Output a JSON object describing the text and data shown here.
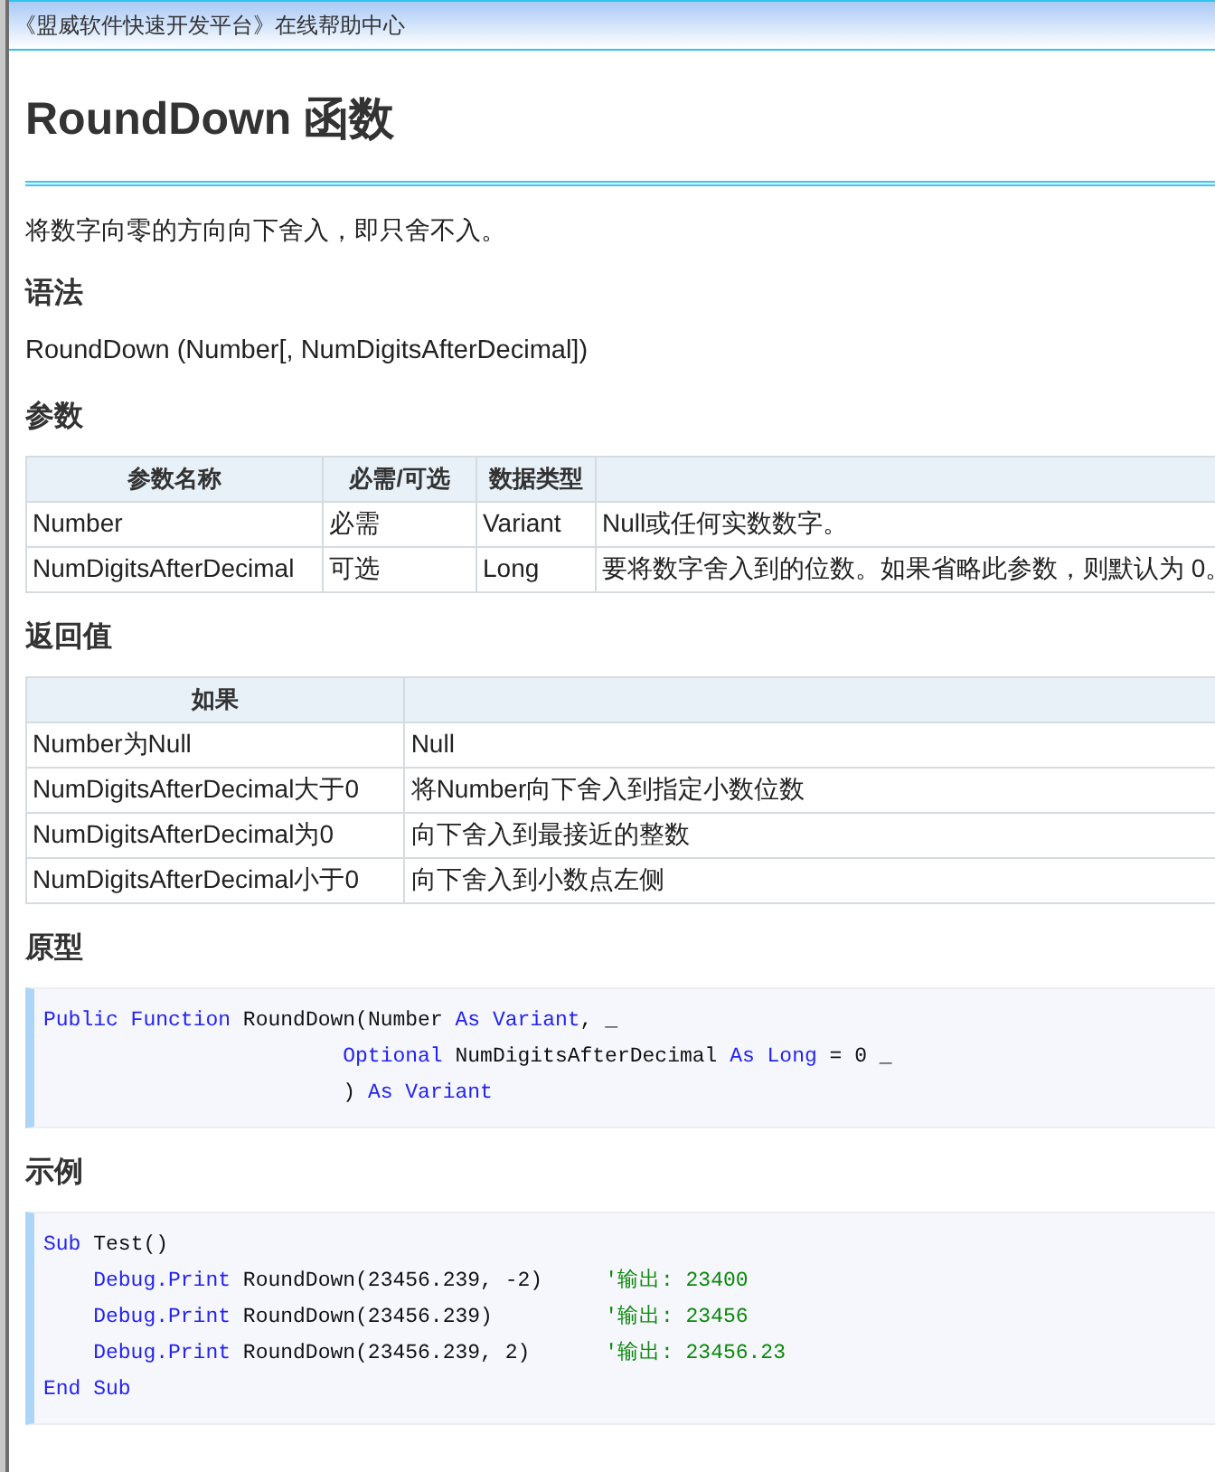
{
  "header": {
    "title": "《盟威软件快速开发平台》在线帮助中心"
  },
  "page_title": "RoundDown 函数",
  "description": "将数字向零的方向向下舍入，即只舍不入。",
  "sections": [
    {
      "kind": "text",
      "heading": "语法",
      "text": "RoundDown (Number[, NumDigitsAfterDecimal])"
    },
    {
      "kind": "table",
      "heading": "参数",
      "columns": [
        "参数名称",
        "必需/可选",
        "数据类型"
      ],
      "rows": [
        [
          "Number",
          "必需",
          "Variant",
          "Null或任何实数数字。"
        ],
        [
          "NumDigitsAfterDecimal",
          "可选",
          "Long",
          "要将数字舍入到的位数。如果省略此参数，则默认为 0。"
        ]
      ]
    },
    {
      "kind": "table",
      "heading": "返回值",
      "columns": [
        "如果"
      ],
      "rows": [
        [
          "Number为Null",
          "Null"
        ],
        [
          "NumDigitsAfterDecimal大于0",
          "将Number向下舍入到指定小数位数"
        ],
        [
          "NumDigitsAfterDecimal为0",
          "向下舍入到最接近的整数"
        ],
        [
          "NumDigitsAfterDecimal小于0",
          "向下舍入到小数点左侧"
        ]
      ]
    },
    {
      "kind": "code",
      "heading": "原型",
      "lines": [
        {
          "kind": "top",
          "tokens": [
            {
              "kind": "keyword",
              "text": "Public Function"
            },
            {
              "kind": "plain",
              "text": " RoundDown(Number "
            },
            {
              "kind": "keyword",
              "text": "As Variant"
            },
            {
              "kind": "plain",
              "text": ", _"
            }
          ]
        },
        {
          "kind": "continuation",
          "tokens": [
            {
              "kind": "keyword",
              "text": "Optional"
            },
            {
              "kind": "plain",
              "text": " NumDigitsAfterDecimal "
            },
            {
              "kind": "keyword",
              "text": "As Long"
            },
            {
              "kind": "plain",
              "text": " = 0 _"
            }
          ]
        },
        {
          "kind": "continuation",
          "tokens": [
            {
              "kind": "plain",
              "text": ") "
            },
            {
              "kind": "keyword",
              "text": "As Variant"
            }
          ]
        }
      ]
    },
    {
      "kind": "code",
      "heading": "示例",
      "lines": [
        {
          "kind": "top",
          "tokens": [
            {
              "kind": "keyword",
              "text": "Sub"
            },
            {
              "kind": "plain",
              "text": " Test()"
            }
          ]
        },
        {
          "kind": "body",
          "tokens": [
            {
              "kind": "keyword",
              "text": "Debug.Print"
            },
            {
              "kind": "plain",
              "text": " RoundDown(23456.239, -2)     "
            },
            {
              "kind": "comment",
              "text": "'输出: 23400"
            }
          ]
        },
        {
          "kind": "body",
          "tokens": [
            {
              "kind": "keyword",
              "text": "Debug.Print"
            },
            {
              "kind": "plain",
              "text": " RoundDown(23456.239)         "
            },
            {
              "kind": "comment",
              "text": "'输出: 23456"
            }
          ]
        },
        {
          "kind": "body",
          "tokens": [
            {
              "kind": "keyword",
              "text": "Debug.Print"
            },
            {
              "kind": "plain",
              "text": " RoundDown(23456.239, 2)      "
            },
            {
              "kind": "comment",
              "text": "'输出: 23456.23"
            }
          ]
        },
        {
          "kind": "top",
          "tokens": [
            {
              "kind": "keyword",
              "text": "End Sub"
            }
          ]
        }
      ]
    }
  ]
}
